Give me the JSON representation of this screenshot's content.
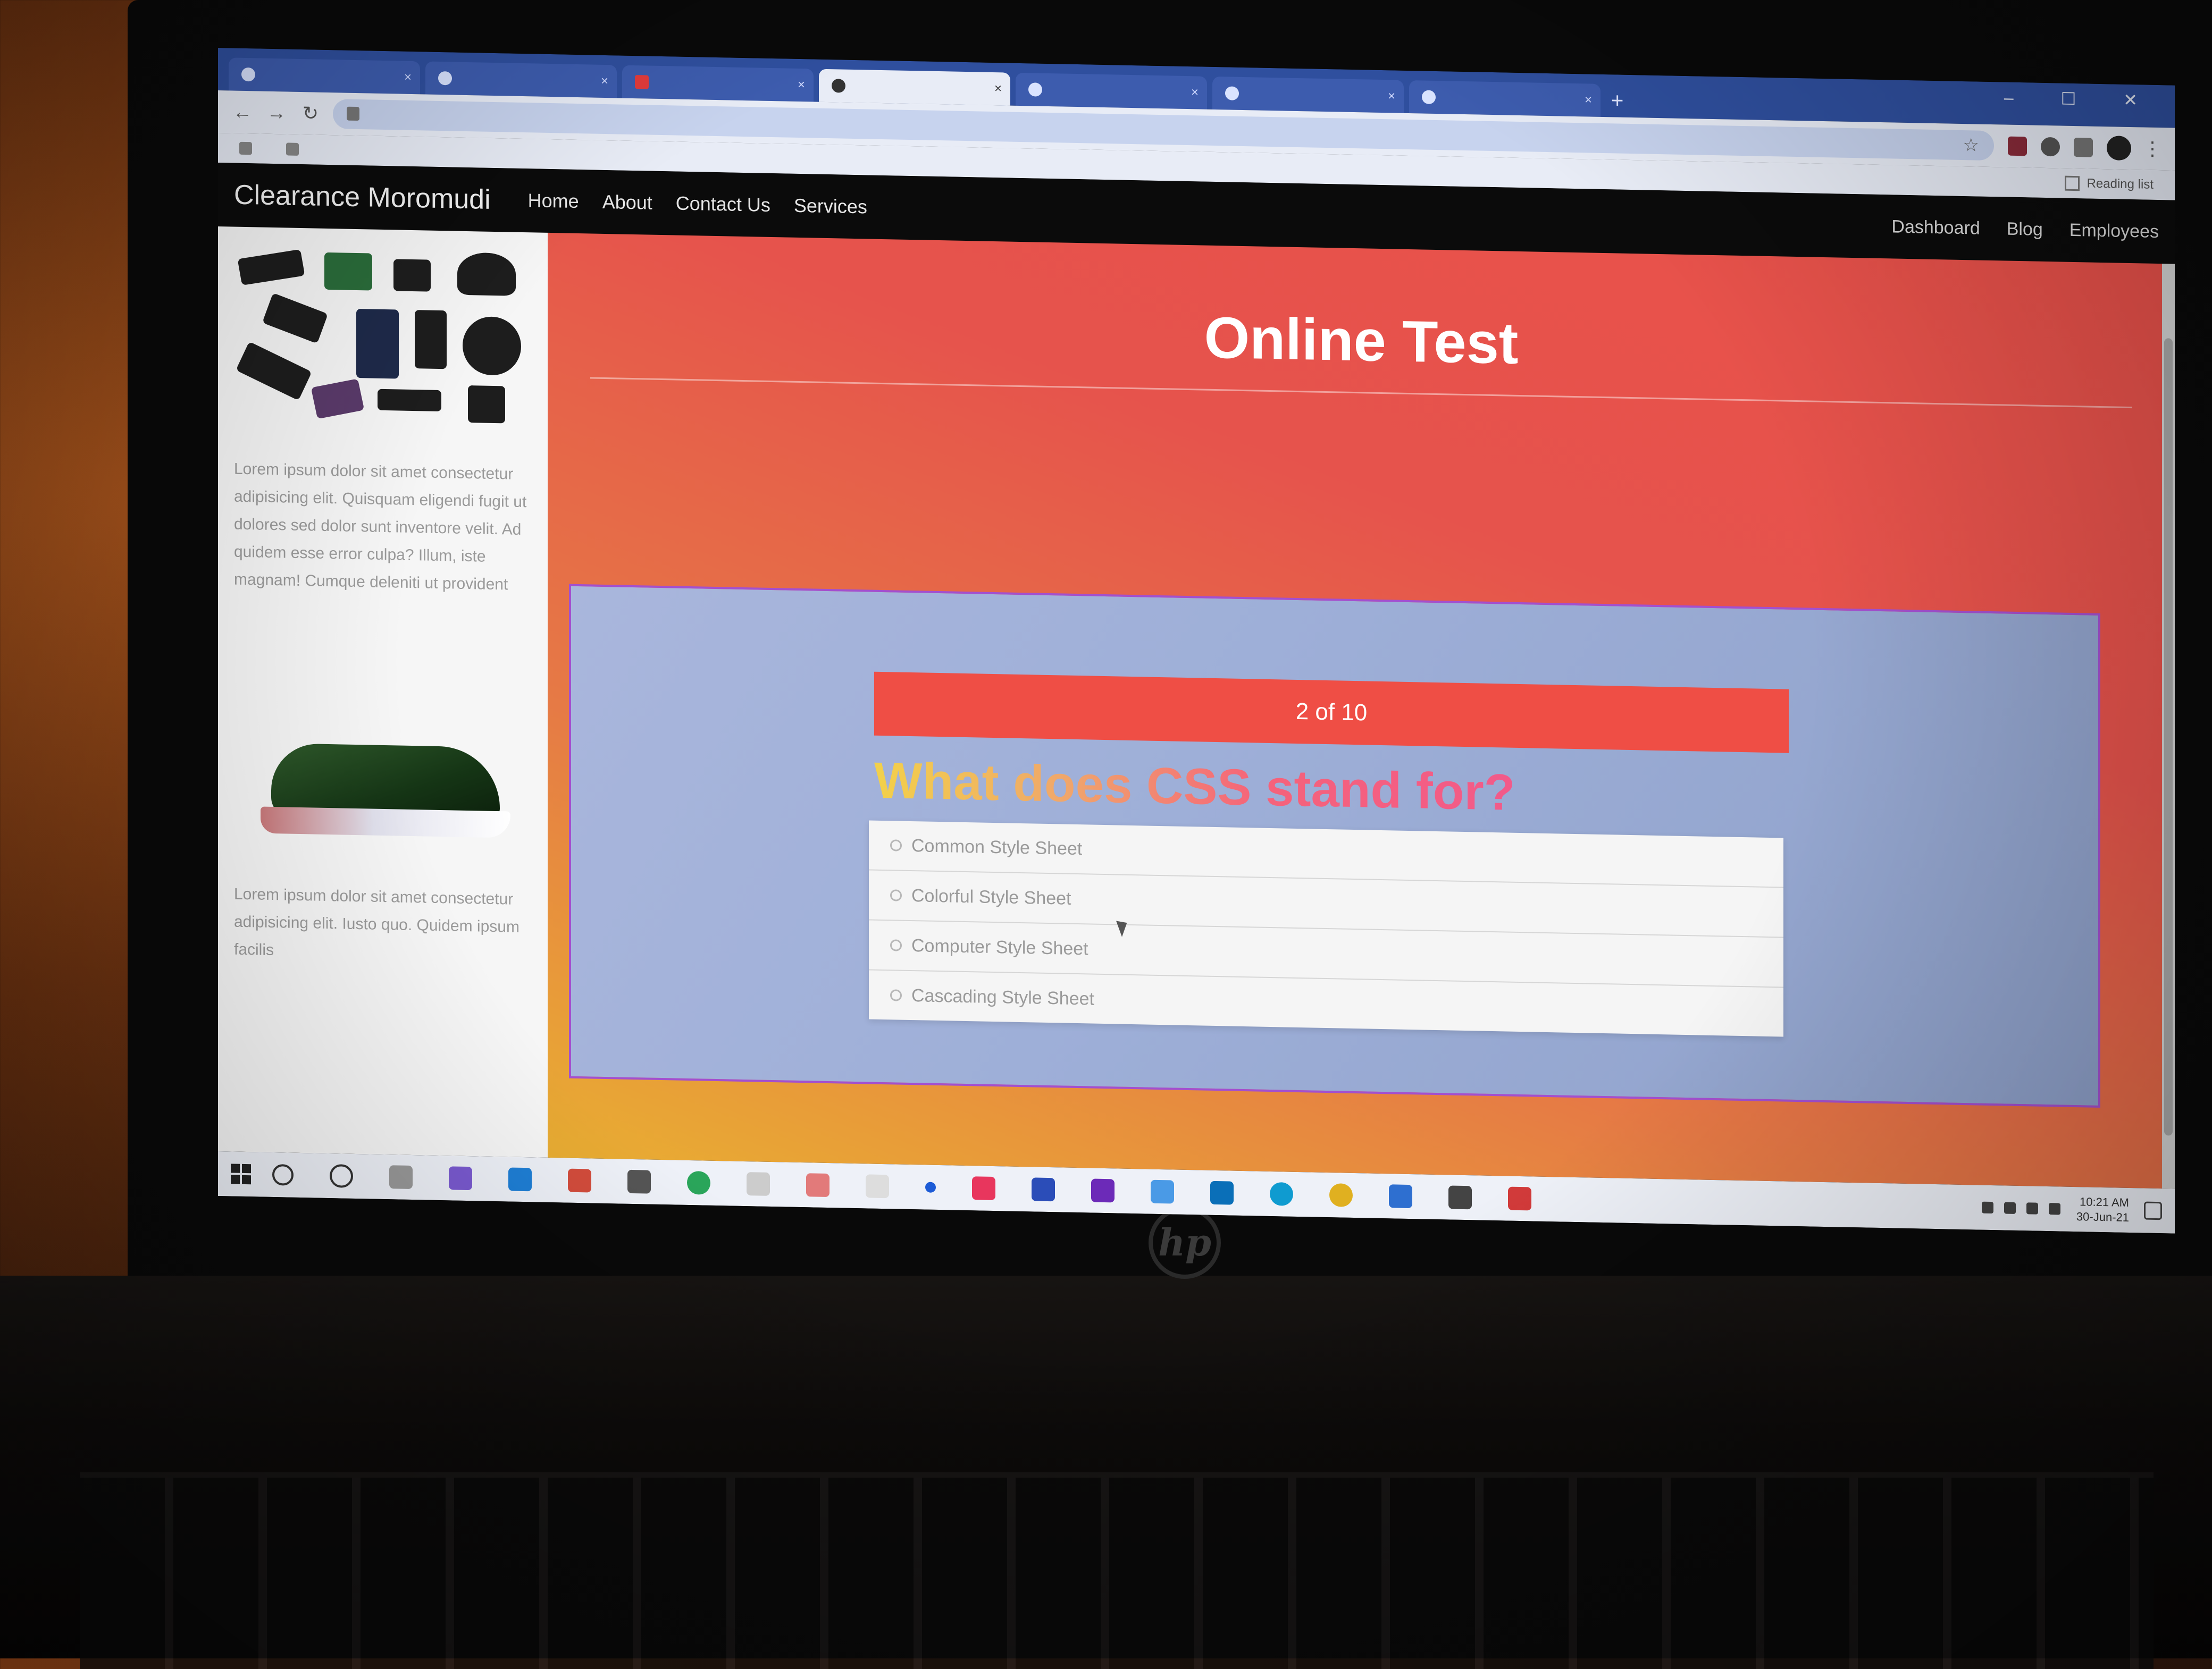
{
  "browser": {
    "tabs": [
      {
        "label": "",
        "state": "inactive"
      },
      {
        "label": "",
        "state": "inactive"
      },
      {
        "label": "",
        "state": "inactive-red"
      },
      {
        "label": "",
        "state": "active"
      },
      {
        "label": "",
        "state": "inactive"
      },
      {
        "label": "",
        "state": "inactive"
      },
      {
        "label": "",
        "state": "inactive"
      }
    ],
    "new_tab_icon": "+",
    "window_controls": "– ☐ ✕",
    "address": "",
    "back_icon": "←",
    "forward_icon": "→",
    "reload_icon": "↻",
    "star_icon": "☆",
    "menu_icon": "⋮",
    "bookmarks": [
      "",
      ""
    ],
    "reading_list": "Reading list"
  },
  "site": {
    "brand": "Clearance Moromudi",
    "nav_left": [
      "Home",
      "About",
      "Contact Us",
      "Services"
    ],
    "nav_right": [
      "Dashboard",
      "Blog",
      "Employees"
    ],
    "sidebar_text_1": "Lorem ipsum dolor sit amet consectetur adipisicing elit. Quisquam eligendi fugit ut dolores sed dolor sunt inventore velit. Ad quidem esse error culpa? Illum, iste magnam! Cumque deleniti ut provident",
    "sidebar_text_2": "Lorem ipsum dolor sit amet consectetur adipisicing elit. Iusto quo. Quidem ipsum facilis"
  },
  "quiz": {
    "title": "Online Test",
    "progress_text": "2 of 10",
    "question": "What does CSS stand for?",
    "answers": [
      "Common Style Sheet",
      "Colorful Style Sheet",
      "Computer Style Sheet",
      "Cascading Style Sheet"
    ]
  },
  "taskbar": {
    "clock_time": "10:21 AM",
    "clock_date": "30-Jun-21"
  },
  "colors": {
    "header_bg": "#0b0b0b",
    "progress_bar": "#ef4e45",
    "gradient_top": "#e9514a",
    "gradient_bottom": "#e9ae32",
    "panel_bg": "#9eafd8"
  }
}
